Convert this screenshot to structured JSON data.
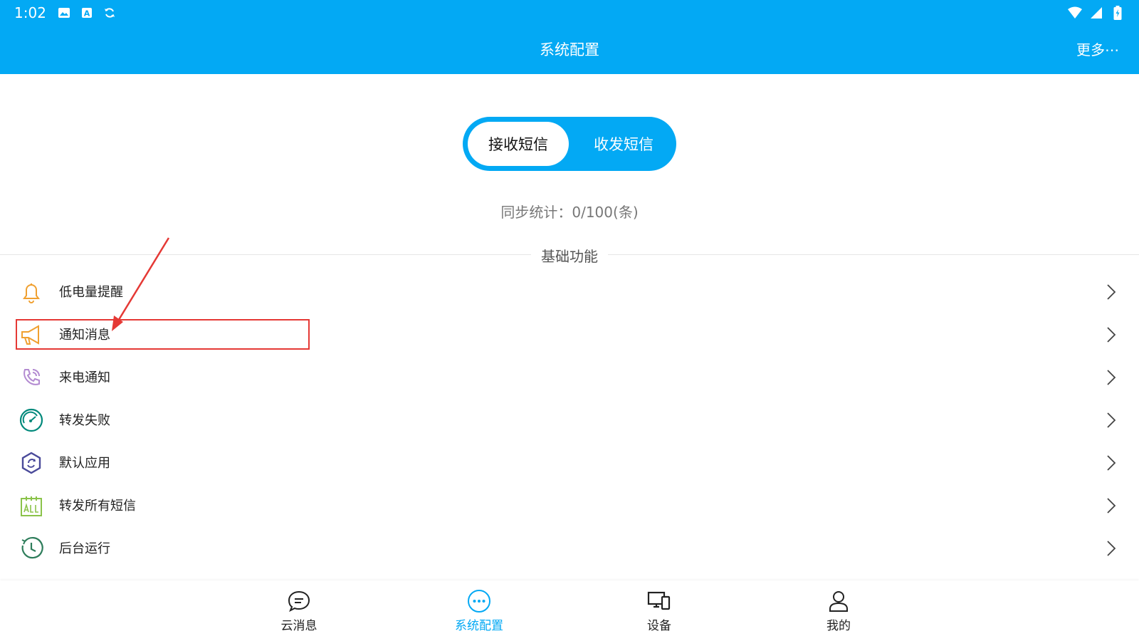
{
  "status_bar": {
    "time": "1:02",
    "left_icons": [
      "image-icon",
      "font-icon",
      "sync-icon"
    ],
    "right_icons": [
      "wifi-icon",
      "signal-icon",
      "battery-icon"
    ]
  },
  "app_bar": {
    "title": "系统配置",
    "more_label": "更多⋯"
  },
  "toggle": {
    "active_label": "接收短信",
    "inactive_label": "收发短信"
  },
  "sync_stats": "同步统计：0/100(条)",
  "section": {
    "title": "基础功能",
    "items": [
      {
        "label": "低电量提醒",
        "icon": "bell-icon"
      },
      {
        "label": "通知消息",
        "icon": "megaphone-icon"
      },
      {
        "label": "来电通知",
        "icon": "phone-icon"
      },
      {
        "label": "转发失败",
        "icon": "gauge-icon"
      },
      {
        "label": "默认应用",
        "icon": "hexagon-refresh-icon"
      },
      {
        "label": "转发所有短信",
        "icon": "all-icon"
      },
      {
        "label": "后台运行",
        "icon": "clock-icon"
      }
    ]
  },
  "colors": {
    "primary": "#03a9f4",
    "bell": "#f0a030",
    "megaphone": "#f0a030",
    "phone": "#b38bd1",
    "gauge": "#00897b",
    "hexagon": "#4a4a9a",
    "all": "#8bc34a",
    "clock": "#2e7d5b",
    "annotation": "#e53935"
  },
  "bottom_nav": [
    {
      "label": "云消息",
      "icon": "chat-icon",
      "active": false
    },
    {
      "label": "系统配置",
      "icon": "more-dots-icon",
      "active": true
    },
    {
      "label": "设备",
      "icon": "devices-icon",
      "active": false
    },
    {
      "label": "我的",
      "icon": "user-icon",
      "active": false
    }
  ]
}
